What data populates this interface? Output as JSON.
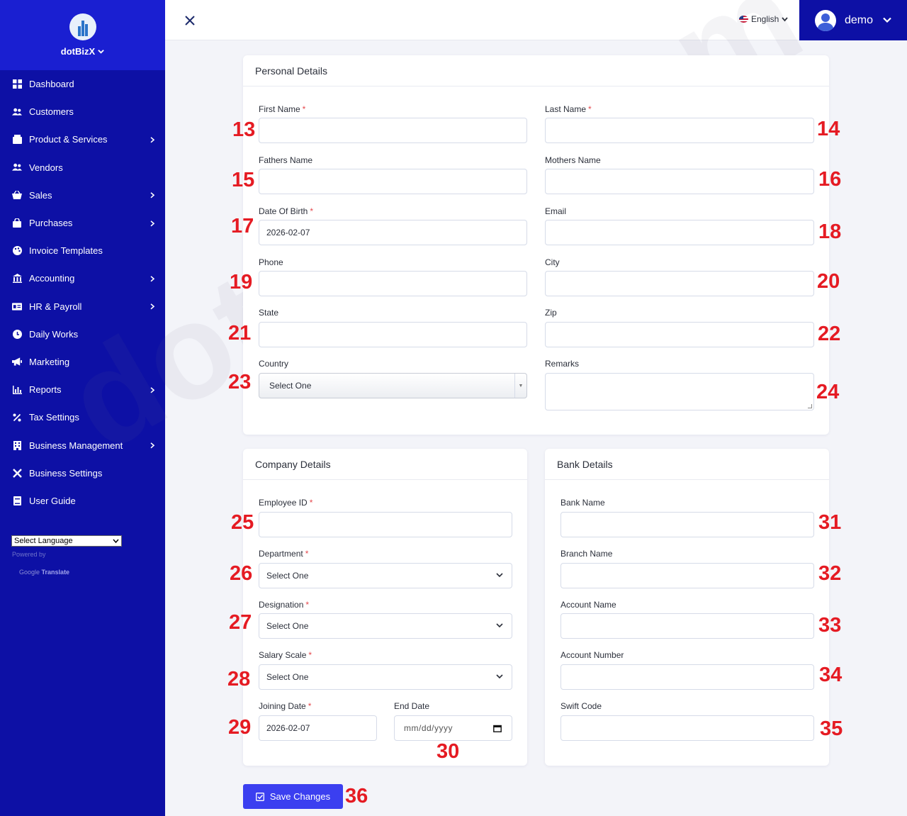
{
  "brand": {
    "name": "dotBizX"
  },
  "sidebar": {
    "items": [
      {
        "label": "Dashboard",
        "icon": "grid-icon",
        "has_sub": false
      },
      {
        "label": "Customers",
        "icon": "users-icon",
        "has_sub": false
      },
      {
        "label": "Product & Services",
        "icon": "box-icon",
        "has_sub": true
      },
      {
        "label": "Vendors",
        "icon": "users-icon",
        "has_sub": false
      },
      {
        "label": "Sales",
        "icon": "basket-icon",
        "has_sub": true
      },
      {
        "label": "Purchases",
        "icon": "bag-icon",
        "has_sub": true
      },
      {
        "label": "Invoice Templates",
        "icon": "palette-icon",
        "has_sub": false
      },
      {
        "label": "Accounting",
        "icon": "bank-icon",
        "has_sub": true
      },
      {
        "label": "HR & Payroll",
        "icon": "id-card-icon",
        "has_sub": true
      },
      {
        "label": "Daily Works",
        "icon": "clock-icon",
        "has_sub": false
      },
      {
        "label": "Marketing",
        "icon": "megaphone-icon",
        "has_sub": false
      },
      {
        "label": "Reports",
        "icon": "bar-chart-icon",
        "has_sub": true
      },
      {
        "label": "Tax Settings",
        "icon": "percent-icon",
        "has_sub": false
      },
      {
        "label": "Business Management",
        "icon": "building-icon",
        "has_sub": true
      },
      {
        "label": "Business Settings",
        "icon": "tools-icon",
        "has_sub": false
      },
      {
        "label": "User Guide",
        "icon": "book-icon",
        "has_sub": false
      }
    ],
    "language_select": "Select Language",
    "powered_by": "Powered by",
    "google": "Google",
    "translate": "Translate"
  },
  "topbar": {
    "language": "English",
    "user": "demo"
  },
  "personal": {
    "title": "Personal Details",
    "first_name": "First Name",
    "last_name": "Last Name",
    "fathers_name": "Fathers Name",
    "mothers_name": "Mothers Name",
    "dob": "Date Of Birth",
    "dob_value": "2026-02-07",
    "email": "Email",
    "phone": "Phone",
    "city": "City",
    "state": "State",
    "zip": "Zip",
    "country": "Country",
    "country_value": "Select One",
    "remarks": "Remarks"
  },
  "company": {
    "title": "Company Details",
    "employee_id": "Employee ID",
    "department": "Department",
    "department_value": "Select One",
    "designation": "Designation",
    "designation_value": "Select One",
    "salary_scale": "Salary Scale",
    "salary_scale_value": "Select One",
    "joining_date": "Joining Date",
    "joining_date_value": "2026-02-07",
    "end_date": "End Date",
    "end_date_placeholder": "mm/dd/yyyy"
  },
  "bank": {
    "title": "Bank Details",
    "bank_name": "Bank Name",
    "branch_name": "Branch Name",
    "account_name": "Account Name",
    "account_number": "Account Number",
    "swift_code": "Swift Code"
  },
  "actions": {
    "save": "Save Changes"
  },
  "annotations": [
    "13",
    "14",
    "15",
    "16",
    "17",
    "18",
    "19",
    "20",
    "21",
    "22",
    "23",
    "24",
    "25",
    "26",
    "27",
    "28",
    "29",
    "30",
    "31",
    "32",
    "33",
    "34",
    "35",
    "36"
  ],
  "watermark": "dotBizX.com",
  "colors": {
    "sidebar": "#0d10a5",
    "brand_header": "#1a1fd1",
    "primary_button": "#3b3ff0",
    "required": "#e5484d",
    "annotation": "#e51b23"
  }
}
